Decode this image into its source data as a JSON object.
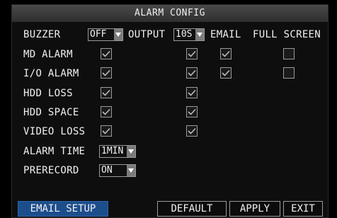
{
  "title": "ALARM CONFIG",
  "header": {
    "buzzer_label": "BUZZER",
    "buzzer_value": "OFF",
    "output_label": "OUTPUT",
    "output_value": "10S",
    "email_label": "EMAIL",
    "fullscreen_label": "FULL SCREEN"
  },
  "rows": [
    {
      "label": "MD ALARM",
      "buzzer": true,
      "output": true,
      "email": true,
      "fullscreen": false
    },
    {
      "label": "I/O ALARM",
      "buzzer": true,
      "output": true,
      "email": true,
      "fullscreen": false
    },
    {
      "label": "HDD LOSS",
      "buzzer": true,
      "output": true
    },
    {
      "label": "HDD SPACE",
      "buzzer": true,
      "output": true
    },
    {
      "label": "VIDEO LOSS",
      "buzzer": true,
      "output": true
    }
  ],
  "alarm_time": {
    "label": "ALARM TIME",
    "value": "1MIN"
  },
  "prerecord": {
    "label": "PRERECORD",
    "value": "ON"
  },
  "buttons": {
    "email_setup": "EMAIL SETUP",
    "default": "DEFAULT",
    "apply": "APPLY",
    "exit": "EXIT"
  },
  "colors": {
    "accent": "#1d4e8c",
    "title_bar": "#3a3a3a"
  }
}
